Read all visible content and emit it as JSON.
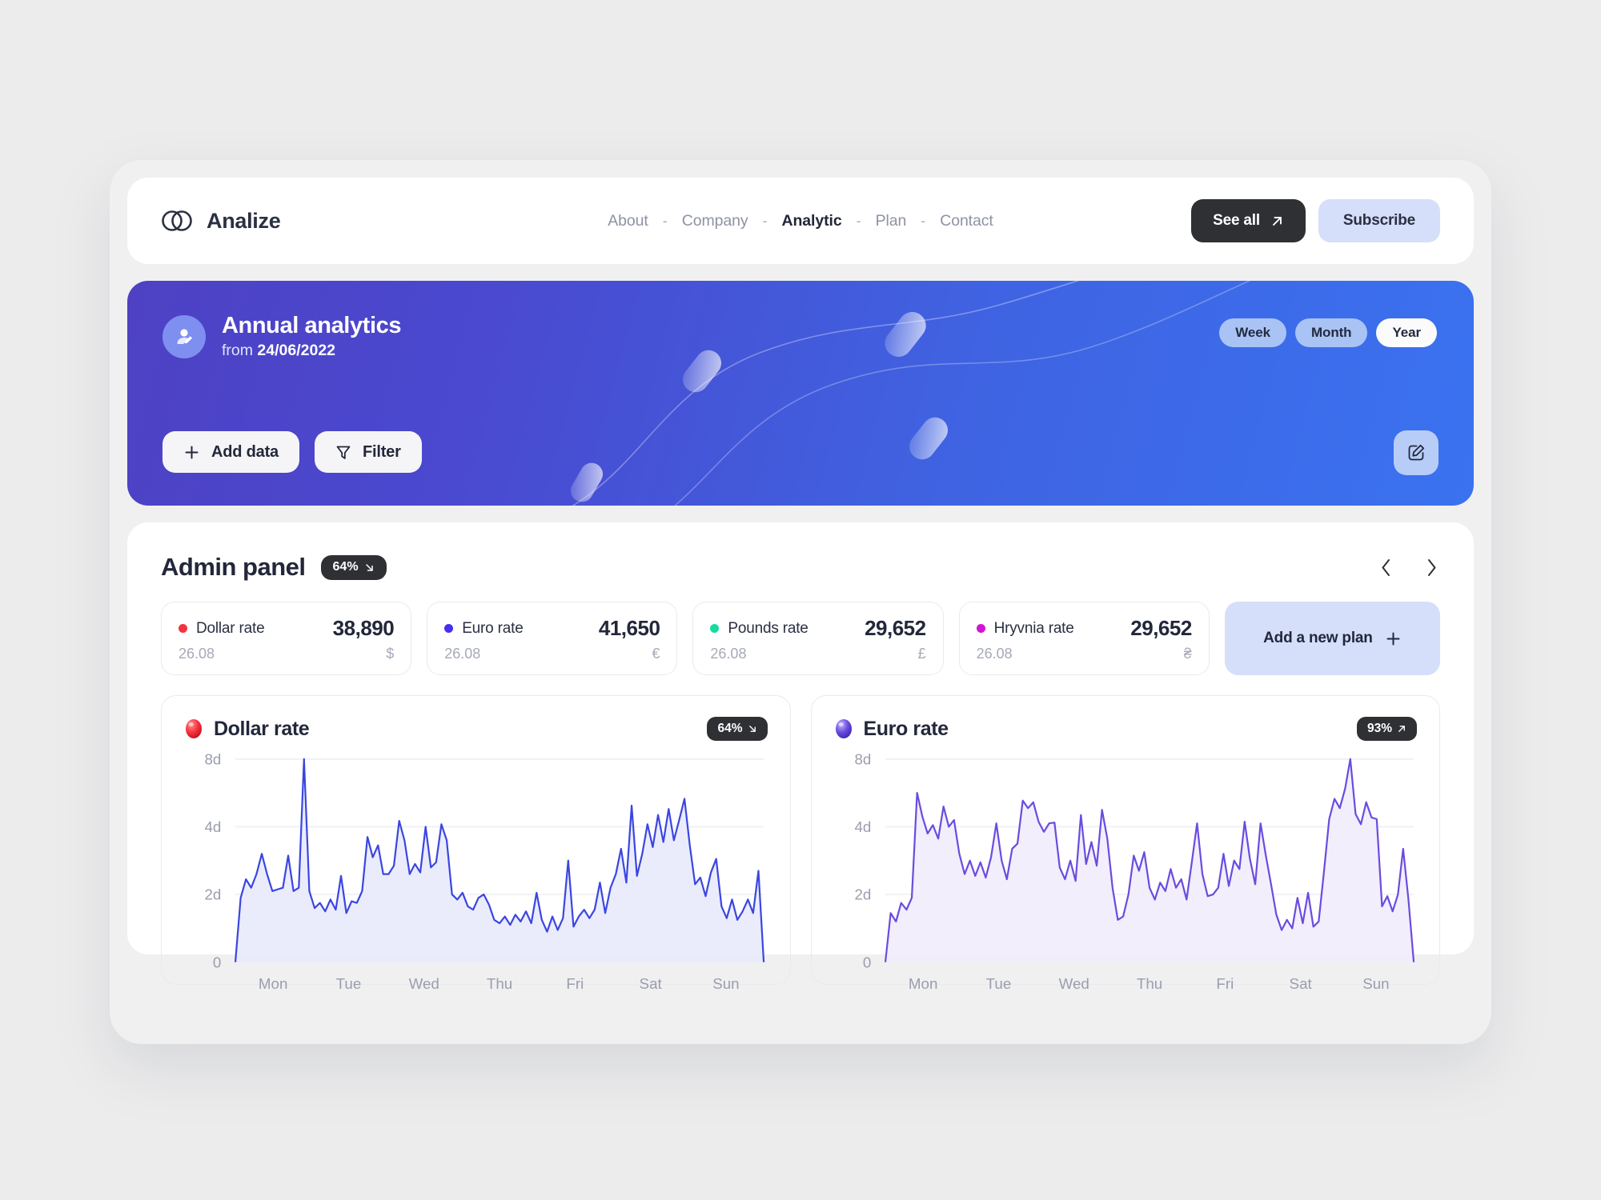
{
  "header": {
    "brand": "Analize",
    "logo_icon": "overlapping-circles-logo",
    "nav": [
      {
        "label": "About",
        "active": false
      },
      {
        "label": "Company",
        "active": false
      },
      {
        "label": "Analytic",
        "active": true
      },
      {
        "label": "Plan",
        "active": false
      },
      {
        "label": "Contact",
        "active": false
      }
    ],
    "separator": "-",
    "see_all_label": "See all",
    "see_all_icon": "arrow-up-right-icon",
    "subscribe_label": "Subscribe"
  },
  "hero": {
    "avatar_icon": "user-edit-avatar-icon",
    "title": "Annual analytics",
    "subtitle_prefix": "from ",
    "date": "24/06/2022",
    "periods": [
      {
        "label": "Week",
        "active": false
      },
      {
        "label": "Month",
        "active": false
      },
      {
        "label": "Year",
        "active": true
      }
    ],
    "add_data_label": "Add data",
    "add_data_icon": "plus-icon",
    "filter_label": "Filter",
    "filter_icon": "funnel-icon",
    "edit_icon": "pencil-edit-icon",
    "gradient_from": "#4e41c4",
    "gradient_to": "#3a72f0"
  },
  "panel": {
    "title": "Admin panel",
    "badge": {
      "value": "64%",
      "icon": "arrow-down-right-icon"
    },
    "prev_icon": "chevron-left-icon",
    "next_icon": "chevron-right-icon",
    "rates": [
      {
        "name": "Dollar rate",
        "value": "38,890",
        "date": "26.08",
        "currency": "$",
        "color": "#f5333f"
      },
      {
        "name": "Euro rate",
        "value": "41,650",
        "date": "26.08",
        "currency": "€",
        "color": "#4530f0"
      },
      {
        "name": "Pounds rate",
        "value": "29,652",
        "date": "26.08",
        "currency": "£",
        "color": "#13dca0"
      },
      {
        "name": "Hryvnia rate",
        "value": "29,652",
        "date": "26.08",
        "currency": "₴",
        "color": "#d413d4"
      }
    ],
    "add_plan_label": "Add a new plan",
    "add_plan_icon": "plus-icon"
  },
  "chart_data": [
    {
      "type": "area",
      "title": "Dollar rate",
      "orb_icon": "red-sphere-icon",
      "badge": {
        "value": "64%",
        "icon": "arrow-down-right-icon",
        "direction": "down"
      },
      "line_color": "#3b46e0",
      "fill_color": "#e8eafc",
      "xlabel": "",
      "ylabel": "",
      "categories": [
        "Mon",
        "Tue",
        "Wed",
        "Thu",
        "Fri",
        "Sat",
        "Sun"
      ],
      "yticks": [
        "0",
        "2d",
        "4d",
        "8d"
      ],
      "ytick_values": [
        0,
        2,
        4,
        8
      ],
      "ylim": [
        0,
        8
      ],
      "grid": true,
      "values": [
        0.0,
        1.9,
        2.45,
        2.2,
        2.6,
        3.2,
        2.6,
        2.1,
        2.15,
        2.2,
        3.15,
        2.1,
        2.2,
        8.0,
        2.1,
        1.6,
        1.75,
        1.5,
        1.85,
        1.55,
        2.55,
        1.45,
        1.8,
        1.75,
        2.1,
        3.7,
        3.1,
        3.45,
        2.6,
        2.6,
        2.85,
        4.35,
        3.6,
        2.6,
        2.9,
        2.65,
        4.0,
        2.8,
        2.95,
        4.15,
        3.6,
        2.0,
        1.85,
        2.05,
        1.65,
        1.55,
        1.9,
        2.0,
        1.7,
        1.25,
        1.15,
        1.35,
        1.1,
        1.4,
        1.2,
        1.5,
        1.15,
        2.05,
        1.25,
        0.9,
        1.35,
        0.95,
        1.3,
        3.0,
        1.05,
        1.35,
        1.55,
        1.3,
        1.55,
        2.35,
        1.45,
        2.2,
        2.6,
        3.35,
        2.35,
        5.25,
        2.55,
        3.2,
        4.15,
        3.4,
        4.7,
        3.55,
        5.05,
        3.6,
        4.4,
        5.65,
        3.45,
        2.3,
        2.5,
        1.95,
        2.65,
        3.05,
        1.65,
        1.3,
        1.85,
        1.25,
        1.5,
        1.85,
        1.45,
        2.7,
        0.0
      ]
    },
    {
      "type": "area",
      "title": "Euro rate",
      "orb_icon": "purple-sphere-icon",
      "badge": {
        "value": "93%",
        "icon": "arrow-up-right-icon",
        "direction": "up"
      },
      "line_color": "#6a4ce0",
      "fill_color": "#f1ecfb",
      "xlabel": "",
      "ylabel": "",
      "categories": [
        "Mon",
        "Tue",
        "Wed",
        "Thu",
        "Fri",
        "Sat",
        "Sun"
      ],
      "yticks": [
        "0",
        "2d",
        "4d",
        "8d"
      ],
      "ytick_values": [
        0,
        2,
        4,
        8
      ],
      "ylim": [
        0,
        8
      ],
      "grid": true,
      "values": [
        0.0,
        1.45,
        1.2,
        1.75,
        1.55,
        1.9,
        6.0,
        4.6,
        3.8,
        4.1,
        3.65,
        5.2,
        4.0,
        4.4,
        3.2,
        2.6,
        3.0,
        2.55,
        2.95,
        2.5,
        3.1,
        4.2,
        3.0,
        2.45,
        3.35,
        3.5,
        5.55,
        5.1,
        5.45,
        4.3,
        3.85,
        4.2,
        4.25,
        2.8,
        2.45,
        3.0,
        2.4,
        4.7,
        2.9,
        3.55,
        2.85,
        5.0,
        3.65,
        2.2,
        1.25,
        1.35,
        2.0,
        3.15,
        2.7,
        3.25,
        2.2,
        1.85,
        2.35,
        2.1,
        2.75,
        2.2,
        2.45,
        1.85,
        2.95,
        4.2,
        2.6,
        1.95,
        2.0,
        2.2,
        3.2,
        2.25,
        3.0,
        2.75,
        4.3,
        3.05,
        2.3,
        4.2,
        3.15,
        2.3,
        1.4,
        0.95,
        1.25,
        1.0,
        1.9,
        1.15,
        2.05,
        1.05,
        1.2,
        2.65,
        4.45,
        5.65,
        5.1,
        6.25,
        8.0,
        4.75,
        4.15,
        5.45,
        4.55,
        4.45,
        1.65,
        1.95,
        1.5,
        2.0,
        3.35,
        1.85,
        0.0
      ]
    }
  ]
}
